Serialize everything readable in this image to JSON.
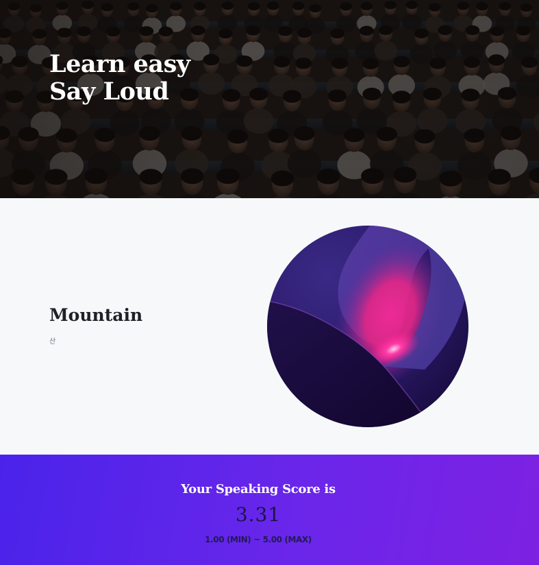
{
  "hero": {
    "title_line1": "Learn easy",
    "title_line2": "Say Loud",
    "image_icon": "audience-photo"
  },
  "word": {
    "title": "Mountain",
    "meaning": "산",
    "image_icon": "abstract-gradient-orb"
  },
  "score": {
    "heading": "Your Speaking Score is",
    "value": "3.31",
    "range": "1.00 (MIN) ~ 5.00 (MAX)"
  },
  "colors": {
    "score_gradient_start": "#4a23ea",
    "score_gradient_end": "#7d21e2",
    "orb_pink": "#ff1f8e",
    "orb_purple": "#4a2e94"
  }
}
